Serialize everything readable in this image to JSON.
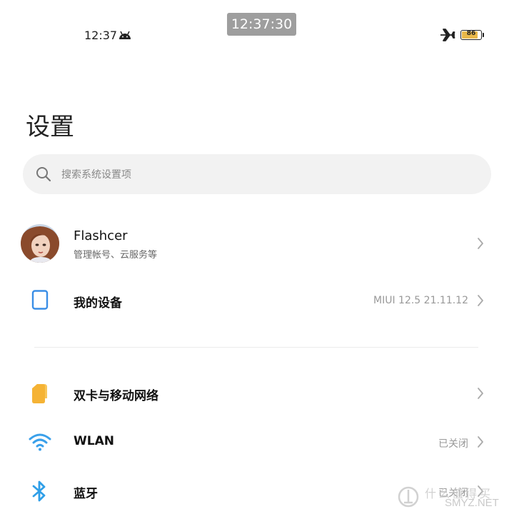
{
  "overlay": {
    "clock": "12:37:30"
  },
  "status_bar": {
    "time": "12:37",
    "battery_level": 86,
    "battery_text": "86"
  },
  "page": {
    "title": "设置"
  },
  "search": {
    "placeholder": "搜索系统设置项"
  },
  "account": {
    "name": "Flashcer",
    "subtitle": "管理帐号、云服务等"
  },
  "items": [
    {
      "label": "我的设备",
      "value": "MIUI 12.5 21.11.12",
      "icon": "tablet-icon",
      "color": "#3a8ee6"
    },
    {
      "label": "双卡与移动网络",
      "value": "",
      "icon": "sim-card-icon",
      "color": "#f5b335"
    },
    {
      "label": "WLAN",
      "value": "已关闭",
      "icon": "wifi-icon",
      "color": "#3aa0ea"
    },
    {
      "label": "蓝牙",
      "value": "已关闭",
      "icon": "bluetooth-icon",
      "color": "#2f9fe8"
    }
  ],
  "watermark": {
    "text": "什么值得买",
    "sub": "SMYZ.NET"
  }
}
